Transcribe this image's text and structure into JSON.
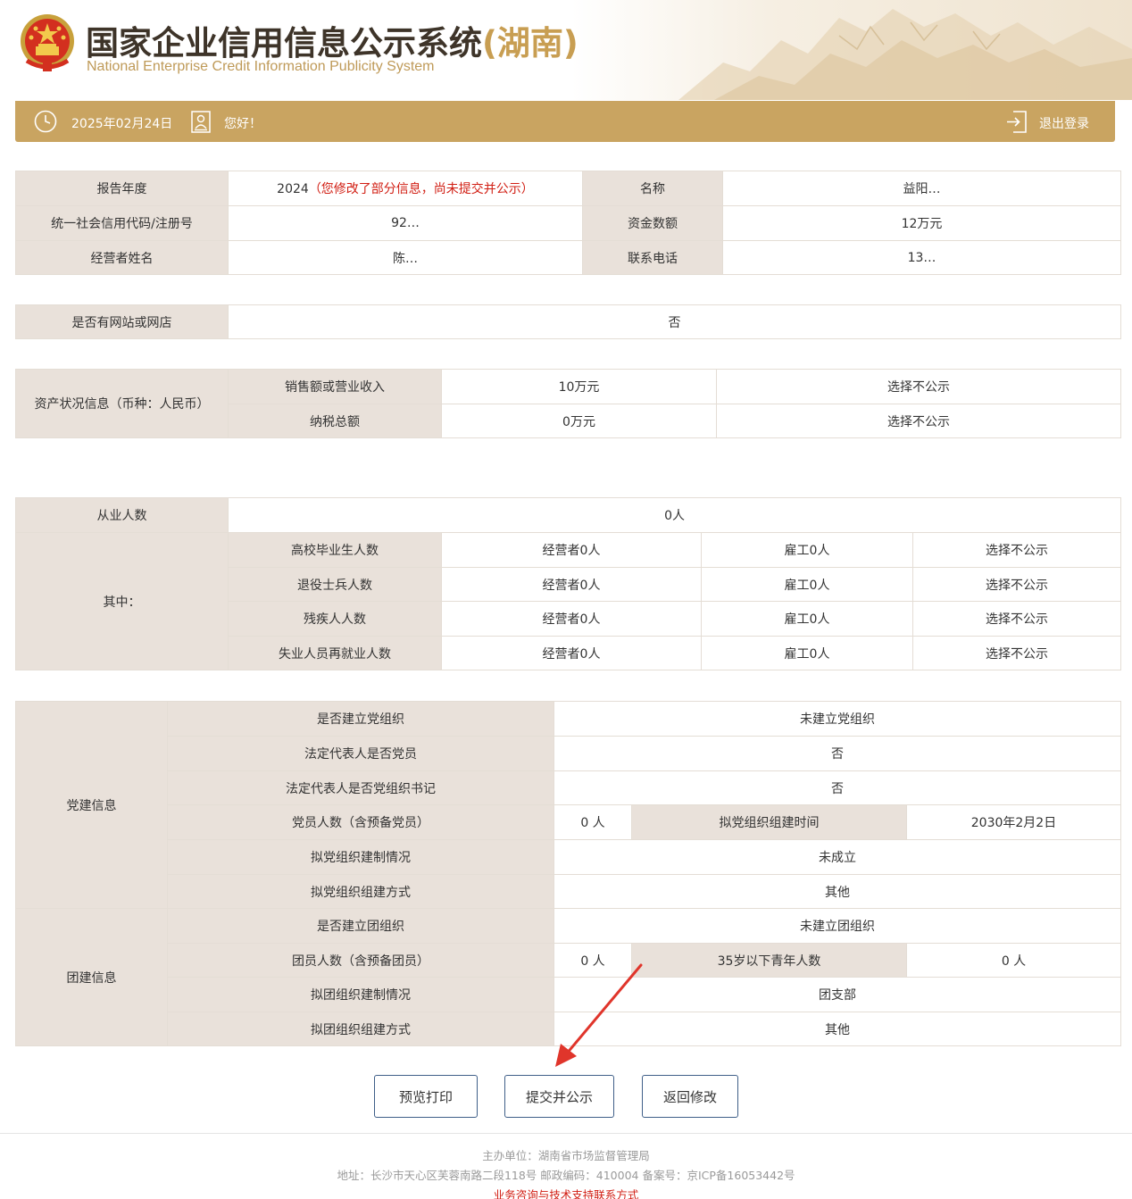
{
  "header": {
    "title_cn_main": "国家企业信用信息公示系统",
    "title_cn_province": "(湖南)",
    "title_en": "National Enterprise Credit Information Publicity System"
  },
  "topbar": {
    "date": "2025年02月24日",
    "greeting": "您好！",
    "logout_label": "退出登录",
    "clock_icon": "clock-icon",
    "user_icon": "user-card-icon",
    "logout_icon": "logout-icon"
  },
  "basic_info": {
    "report_year_label": "报告年度",
    "report_year": "2024",
    "report_year_warning": "（您修改了部分信息，尚未提交并公示）",
    "name_label": "名称",
    "name_value": "益阳…",
    "credit_code_label": "统一社会信用代码/注册号",
    "credit_code_value": "92…",
    "capital_label": "资金数额",
    "capital_value": "12万元",
    "operator_label": "经营者姓名",
    "operator_value": "陈…",
    "phone_label": "联系电话",
    "phone_value": "13…"
  },
  "website": {
    "label": "是否有网站或网店",
    "value": "否"
  },
  "assets": {
    "section_label": "资产状况信息（币种：人民币）",
    "rows": [
      {
        "label": "销售额或营业收入",
        "value": "10万元",
        "visibility": "选择不公示"
      },
      {
        "label": "纳税总额",
        "value": "0万元",
        "visibility": "选择不公示"
      }
    ]
  },
  "employees": {
    "total_label": "从业人数",
    "total_value": "0人",
    "group_label": "其中：",
    "rows": [
      {
        "label": "高校毕业生人数",
        "operator": "经营者0人",
        "employee": "雇工0人",
        "visibility": "选择不公示"
      },
      {
        "label": "退役士兵人数",
        "operator": "经营者0人",
        "employee": "雇工0人",
        "visibility": "选择不公示"
      },
      {
        "label": "残疾人人数",
        "operator": "经营者0人",
        "employee": "雇工0人",
        "visibility": "选择不公示"
      },
      {
        "label": "失业人员再就业人数",
        "operator": "经营者0人",
        "employee": "雇工0人",
        "visibility": "选择不公示"
      }
    ]
  },
  "party": {
    "section_label": "党建信息",
    "established_label": "是否建立党组织",
    "established_value": "未建立党组织",
    "rep_member_label": "法定代表人是否党员",
    "rep_member_value": "否",
    "rep_secretary_label": "法定代表人是否党组织书记",
    "rep_secretary_value": "否",
    "members_label": "党员人数（含预备党员）",
    "members_value": "0 人",
    "plan_time_label": "拟党组织组建时间",
    "plan_time_value": "2030年2月2日",
    "plan_type_label": "拟党组织建制情况",
    "plan_type_value": "未成立",
    "plan_method_label": "拟党组织组建方式",
    "plan_method_value": "其他"
  },
  "league": {
    "section_label": "团建信息",
    "established_label": "是否建立团组织",
    "established_value": "未建立团组织",
    "members_label": "团员人数（含预备团员）",
    "members_value": "0 人",
    "youth_label": "35岁以下青年人数",
    "youth_value": "0 人",
    "plan_type_label": "拟团组织建制情况",
    "plan_type_value": "团支部",
    "plan_method_label": "拟团组织组建方式",
    "plan_method_value": "其他"
  },
  "actions": {
    "preview_label": "预览打印",
    "submit_label": "提交并公示",
    "back_label": "返回修改"
  },
  "footer": {
    "sponsor": "主办单位：湖南省市场监督管理局",
    "address": "地址：长沙市天心区芙蓉南路二段118号 邮政编码：410004 备案号：京ICP备16053442号",
    "support_link": "业务咨询与技术支持联系方式"
  },
  "colors": {
    "gold_bar": "#c9a461",
    "label_bg": "#e9e1da",
    "warning_red": "#d11d12",
    "button_border": "#3f5f88",
    "arrow_red": "#e0352b"
  }
}
